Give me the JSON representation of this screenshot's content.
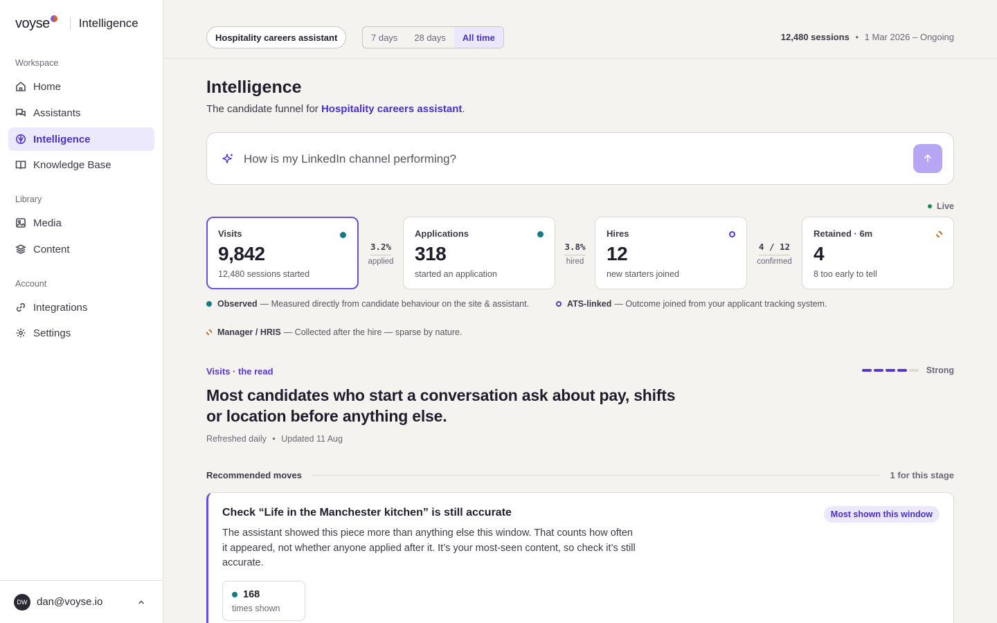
{
  "brand": {
    "logo": "voyse",
    "product": "Intelligence"
  },
  "sidebar": {
    "sections": [
      "Workspace",
      "Library",
      "Account"
    ],
    "items": [
      {
        "label": "Home",
        "icon": "home-icon"
      },
      {
        "label": "Assistants",
        "icon": "chat-icon"
      },
      {
        "label": "Intelligence",
        "icon": "brain-icon",
        "active": true
      },
      {
        "label": "Knowledge Base",
        "icon": "book-icon"
      },
      {
        "label": "Media",
        "icon": "image-icon"
      },
      {
        "label": "Content",
        "icon": "layers-icon"
      },
      {
        "label": "Integrations",
        "icon": "link-icon"
      },
      {
        "label": "Settings",
        "icon": "gear-icon"
      }
    ],
    "user": {
      "initials": "DW",
      "email": "dan@voyse.io"
    }
  },
  "topbar": {
    "assistant": "Hospitality careers assistant",
    "ranges": [
      "7 days",
      "28 days",
      "All time"
    ],
    "selected_range": "All time",
    "sessions": "12,480 sessions",
    "dot": "•",
    "period": "1 Mar 2026 – Ongoing"
  },
  "header": {
    "title": "Intelligence",
    "subtitle_prefix": "The candidate funnel for ",
    "subtitle_link": "Hospitality careers assistant",
    "subtitle_suffix": "."
  },
  "ask": {
    "placeholder": "How is my LinkedIn channel performing?"
  },
  "live_label": "Live",
  "funnel": {
    "cards": [
      {
        "label": "Visits",
        "value": "9,842",
        "sub": "12,480 sessions started",
        "source": "observed"
      },
      {
        "label": "Applications",
        "value": "318",
        "sub": "started an application",
        "source": "observed"
      },
      {
        "label": "Hires",
        "value": "12",
        "sub": "new starters joined",
        "source": "ats"
      },
      {
        "label": "Retained · 6m",
        "value": "4",
        "sub": "8 too early to tell",
        "source": "hris"
      }
    ],
    "connectors": [
      {
        "value": "3.2%",
        "caption": "applied"
      },
      {
        "value": "3.8%",
        "caption": "hired"
      },
      {
        "value": "4 / 12",
        "caption": "confirmed"
      }
    ]
  },
  "legend": [
    {
      "name": "Observed",
      "desc": "— Measured directly from candidate behaviour on the site & assistant."
    },
    {
      "name": "ATS-linked",
      "desc": "— Outcome joined from your applicant tracking system."
    },
    {
      "name": "Manager / HRIS",
      "desc": "— Collected after the hire — sparse by nature."
    }
  ],
  "insight": {
    "eyebrow": "Visits · the read",
    "strength_label": "Strong",
    "strength_level": 4,
    "strength_max": 5,
    "headline": "Most candidates who start a conversation ask about pay, shifts or location before anything else.",
    "refreshed": "Refreshed daily",
    "dot": "•",
    "updated": "Updated 11 Aug"
  },
  "recommended": {
    "heading": "Recommended moves",
    "count": "1 for this stage",
    "card": {
      "title": "Check “Life in the Manchester kitchen” is still accurate",
      "badge": "Most shown this window",
      "body": "The assistant showed this piece more than anything else this window. That counts how often it appeared, not whether anyone applied after it. It’s your most-seen content, so check it’s still accurate.",
      "stat_value": "168",
      "stat_label": "times shown"
    }
  },
  "colors": {
    "accent": "#5535d6",
    "observed": "#137a86",
    "ats": "#5535d6",
    "hris": "#c4661f",
    "live": "#1b8a5a"
  }
}
